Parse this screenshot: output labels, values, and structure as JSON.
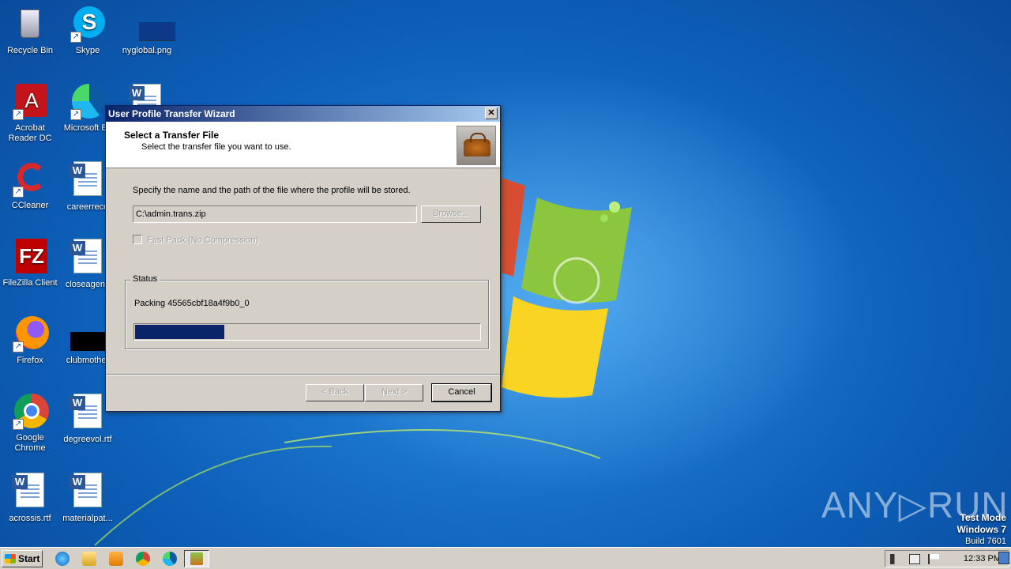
{
  "desktop": {
    "icons": [
      {
        "label": "Recycle Bin",
        "icon": "recycle-bin-icon"
      },
      {
        "label": "Skype",
        "icon": "skype-icon"
      },
      {
        "label": "nyglobal.png",
        "icon": "image-file-icon"
      },
      {
        "label": "Acrobat Reader DC",
        "icon": "acrobat-icon"
      },
      {
        "label": "Microsoft Ec",
        "icon": "edge-icon"
      },
      {
        "label": "CCleaner",
        "icon": "ccleaner-icon"
      },
      {
        "label": "careerreco",
        "icon": "word-doc-icon"
      },
      {
        "label": "FileZilla Client",
        "icon": "filezilla-icon"
      },
      {
        "label": "closeagent.",
        "icon": "word-doc-icon"
      },
      {
        "label": "Firefox",
        "icon": "firefox-icon"
      },
      {
        "label": "clubmother",
        "icon": "black-file-icon"
      },
      {
        "label": "Google Chrome",
        "icon": "chrome-icon"
      },
      {
        "label": "degreevol.rtf",
        "icon": "word-doc-icon"
      },
      {
        "label": "acrossis.rtf",
        "icon": "word-doc-icon"
      },
      {
        "label": "materialpat...",
        "icon": "word-doc-icon"
      }
    ]
  },
  "wizard": {
    "title": "User Profile Transfer Wizard",
    "close_glyph": "✕",
    "header_title": "Select a Transfer File",
    "header_subtitle": "Select the transfer file you want to use.",
    "instruction": "Specify the name and the path of the file where the profile will be stored.",
    "path_value": "C:\\admin.trans.zip",
    "browse_label": "Browse...",
    "fastpack_label": "Fast Pack (No Compression)",
    "status_legend": "Status",
    "status_text": "Packing 45565cbf18a4f9b0_0",
    "progress_percent": 26,
    "back_label": "< Back",
    "next_label": "Next >",
    "cancel_label": "Cancel"
  },
  "taskbar": {
    "start_label": "Start",
    "clock": "12:33 PM",
    "pinned": [
      "ie-icon",
      "explorer-icon",
      "media-player-icon",
      "chrome-icon",
      "edge-icon",
      "wizard-task-icon"
    ]
  },
  "watermark": {
    "brand": "ANY▷RUN",
    "line1": "Test Mode",
    "line2": "Windows 7",
    "line3": "Build 7601"
  },
  "colors": {
    "titlebar_start": "#0a246a",
    "titlebar_end": "#a6caf0",
    "dialog_face": "#d4d0c8",
    "progress_fill": "#0a246a"
  }
}
